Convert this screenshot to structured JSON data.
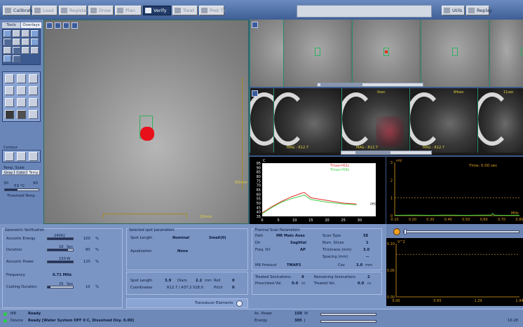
{
  "toolbar": {
    "calibrate": "Calibrate",
    "load": "Load",
    "register": "Register",
    "draw": "Draw",
    "plan": "Plan",
    "verify": "Verify",
    "treat": "Treat",
    "post_tx": "Post Tx",
    "utils": "Utils",
    "replay": "Replay"
  },
  "tools_panel": {
    "tabs": [
      "Tools",
      "Overlays"
    ],
    "contour_label": "Contour",
    "temp_scale_label": "Temp. Scale",
    "scale_buttons": [
      "Gray",
      "Color",
      "Temp"
    ],
    "threshold_min": "30",
    "threshold_max": "90",
    "threshold_value": "53 °C",
    "threshold_label": "Threshold Temp."
  },
  "main_image": {
    "scale_label": "20mm",
    "side_label": "83mm"
  },
  "strip2": {
    "labels": [
      {
        "text": "42sec"
      },
      {
        "text": "0sec"
      },
      {
        "text": "84sec"
      },
      {
        "text": "11sec"
      }
    ],
    "mag_labels": [
      "MAG : R12.7",
      "MAG : R12.7",
      "MAG : R12.7"
    ]
  },
  "temp_chart": {
    "y_unit": "C",
    "legend": [
      "Tmax=62c",
      "Tmax=59c"
    ],
    "x_unit": "sec"
  },
  "spec_chart": {
    "y_unit": "mV",
    "time_text": "Time: 0.00 sec",
    "x_unit": "MHz"
  },
  "vsq_chart": {
    "y_unit": "V^2"
  },
  "chart_data": [
    {
      "type": "line",
      "title": "",
      "xlabel": "sec",
      "ylabel": "C",
      "xlim": [
        0,
        35
      ],
      "ylim": [
        35,
        95
      ],
      "xticks": [
        0,
        5,
        10,
        15,
        20,
        25,
        30
      ],
      "yticks": [
        35,
        40,
        45,
        50,
        55,
        60,
        65,
        70,
        75,
        80,
        85,
        90,
        95
      ],
      "series": [
        {
          "name": "Tmax=62c",
          "color": "#e03030",
          "x": [
            0,
            3,
            6,
            9,
            12,
            13,
            15,
            20,
            25,
            29
          ],
          "y": [
            39,
            46,
            52,
            57,
            61,
            62,
            56,
            53,
            50,
            49
          ]
        },
        {
          "name": "Tmax=59c",
          "color": "#40d040",
          "x": [
            0,
            3,
            6,
            9,
            12,
            13,
            15,
            20,
            25,
            29
          ],
          "y": [
            38,
            45,
            51,
            55,
            58,
            59,
            54,
            51,
            49,
            48
          ]
        }
      ]
    },
    {
      "type": "line",
      "title": "",
      "xlabel": "MHz",
      "ylabel": "mV",
      "xlim": [
        0.1,
        0.8
      ],
      "ylim": [
        0,
        3
      ],
      "xticks": [
        "0.10",
        "0.20",
        "0.30",
        "0.40",
        "0.50",
        "0.60",
        "0.70",
        "0.80"
      ],
      "yticks": [
        0,
        1,
        2,
        3
      ],
      "threshold": 1,
      "series": [
        {
          "color": "#40d040",
          "x": [
            0.1,
            0.2,
            0.3,
            0.4,
            0.5,
            0.6,
            0.64,
            0.65,
            0.66,
            0.7,
            0.8
          ],
          "y": [
            0.02,
            0.03,
            0.02,
            0.03,
            0.02,
            0.03,
            0.03,
            0.12,
            0.03,
            0.02,
            0.02
          ]
        }
      ]
    },
    {
      "type": "line",
      "title": "",
      "xlabel": "",
      "ylabel": "V^2",
      "xlim": [
        0,
        1.94
      ],
      "ylim": [
        0,
        0.1
      ],
      "xticks": [
        "0.00",
        "0.65",
        "1.29",
        "1.94"
      ],
      "yticks": [
        "0.00",
        "0.05",
        "0.10"
      ],
      "threshold": 0.08,
      "series": []
    }
  ],
  "geometric": {
    "title": "Geometric Verification",
    "rows": [
      {
        "label": "Acoustic Energy",
        "value": "2400",
        "unit": "J",
        "pct": "100",
        "fill": 1.0
      },
      {
        "label": "Duration",
        "value": "16",
        "unit": "Sec",
        "pct": "80",
        "fill": 0.8
      },
      {
        "label": "Acoustic Power",
        "value": "150",
        "unit": "W",
        "pct": "125",
        "fill": 1.0
      },
      {
        "label": "Cooling Duration",
        "value": "25",
        "unit": "Sec",
        "pct": "10",
        "fill": 0.1
      }
    ],
    "frequency_label": "Frequency",
    "frequency_value": "0.71 MHz",
    "pct_unit": "%"
  },
  "spot": {
    "title": "Selected spot parameters",
    "spot_length_label": "Spot Length",
    "spot_length_value": "Nominal",
    "spot_length_size": "Small(0)",
    "apodization_label": "Apodization",
    "apodization_value": "None",
    "spot_length2_label": "Spot Length",
    "spot_length2_value": "3.9",
    "diam_label": "Diam",
    "diam_value": "2.2",
    "diam_unit": "mm",
    "roll_label": "Roll",
    "roll_value": "0",
    "coords_label": "Coordinates",
    "coords_value": "R12.7 / A37.2 S18.0",
    "pitch_label": "Pitch",
    "pitch_value": "0",
    "transducer_label": "Transducer Elements"
  },
  "thermal": {
    "title": "Thermal Scan Parameters",
    "path_label": "Path",
    "path_value": "MR Main Axes",
    "dir_label": "Dir",
    "dir_value": "Sagittal",
    "freq_dir_label": "Freq. Dir",
    "freq_dir_value": "AP",
    "mr_protocol_label": "MR Protocol",
    "mr_protocol_value": "TMAP3",
    "scan_type_label": "Scan Type",
    "scan_type_value": "SE",
    "num_slices_label": "Num. Slices",
    "num_slices_value": "1",
    "thickness_label": "Thickness (mm)",
    "thickness_value": "3.0",
    "spacing_label": "Spacing (mm)",
    "spacing_value": "--",
    "cov_label": "Cov",
    "cov_value": "3.0",
    "cov_unit": "mm"
  },
  "sonications": {
    "treated_label": "Treated Sonications",
    "treated_value": "9",
    "prescribed_label": "Prescribed Vol.",
    "prescribed_value": "0.0",
    "prescribed_unit": "cc",
    "remaining_label": "Remaining Sonications",
    "remaining_value": "2",
    "treated_vol_label": "Treated Vol.",
    "treated_vol_value": "0.0",
    "treated_vol_unit": "cc"
  },
  "status": {
    "mr_label": "MR",
    "mr_value": "Ready",
    "device_label": "Device",
    "device_value": "Ready [Water System OFF 0 C, Dissolved Oxy. 0.00]",
    "ac_power_label": "Ac. Power",
    "ac_power_value": "150",
    "ac_power_unit": "W",
    "energy_label": "Energy",
    "energy_value": "305",
    "energy_unit": "J",
    "time": "16:28"
  },
  "colors": {
    "accent": "#3a5a8a",
    "panel": "#7a94c4",
    "ready_led": "#2ad040"
  }
}
